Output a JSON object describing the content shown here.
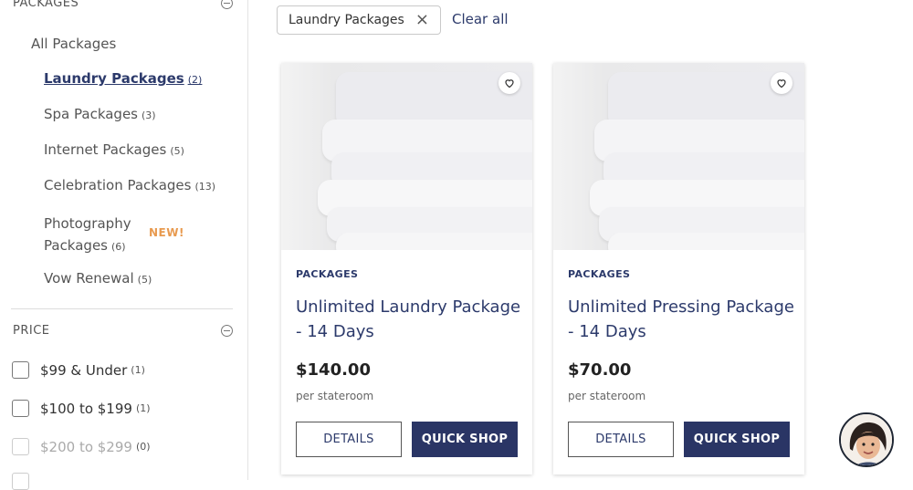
{
  "sidebar": {
    "packages_heading": "PACKAGES",
    "all_packages": "All Packages",
    "categories": [
      {
        "label": "Laundry Packages",
        "count": "(2)"
      },
      {
        "label": "Spa Packages",
        "count": "(3)"
      },
      {
        "label": "Internet Packages",
        "count": "(5)"
      },
      {
        "label": "Celebration Packages",
        "count": "(13)"
      },
      {
        "label_line1": "Photography",
        "label_line2": "Packages",
        "count": "(6)"
      },
      {
        "label": "Vow Renewal",
        "count": "(5)"
      }
    ],
    "new_badge": "NEW!",
    "price_heading": "PRICE",
    "price_filters": [
      {
        "label": "$99 & Under",
        "count": "(1)"
      },
      {
        "label": "$100 to $199",
        "count": "(1)"
      },
      {
        "label": "$200 to $299",
        "count": "(0)"
      }
    ]
  },
  "filters": {
    "active_chip": "Laundry Packages",
    "chip_remove_icon": "close-icon",
    "clear_all": "Clear all"
  },
  "products": [
    {
      "category": "PACKAGES",
      "title": "Unlimited Laundry Package - 14 Days",
      "price": "$140.00",
      "price_note": "per stateroom",
      "details_label": "DETAILS",
      "quick_shop_label": "QUICK SHOP"
    },
    {
      "category": "PACKAGES",
      "title": "Unlimited Pressing Package - 14 Days",
      "price": "$70.00",
      "price_note": "per stateroom",
      "details_label": "DETAILS",
      "quick_shop_label": "QUICK SHOP"
    }
  ],
  "colors": {
    "brand_navy": "#2a3565",
    "link_navy": "#2c3a6b",
    "new_badge": "#e89a4f"
  }
}
